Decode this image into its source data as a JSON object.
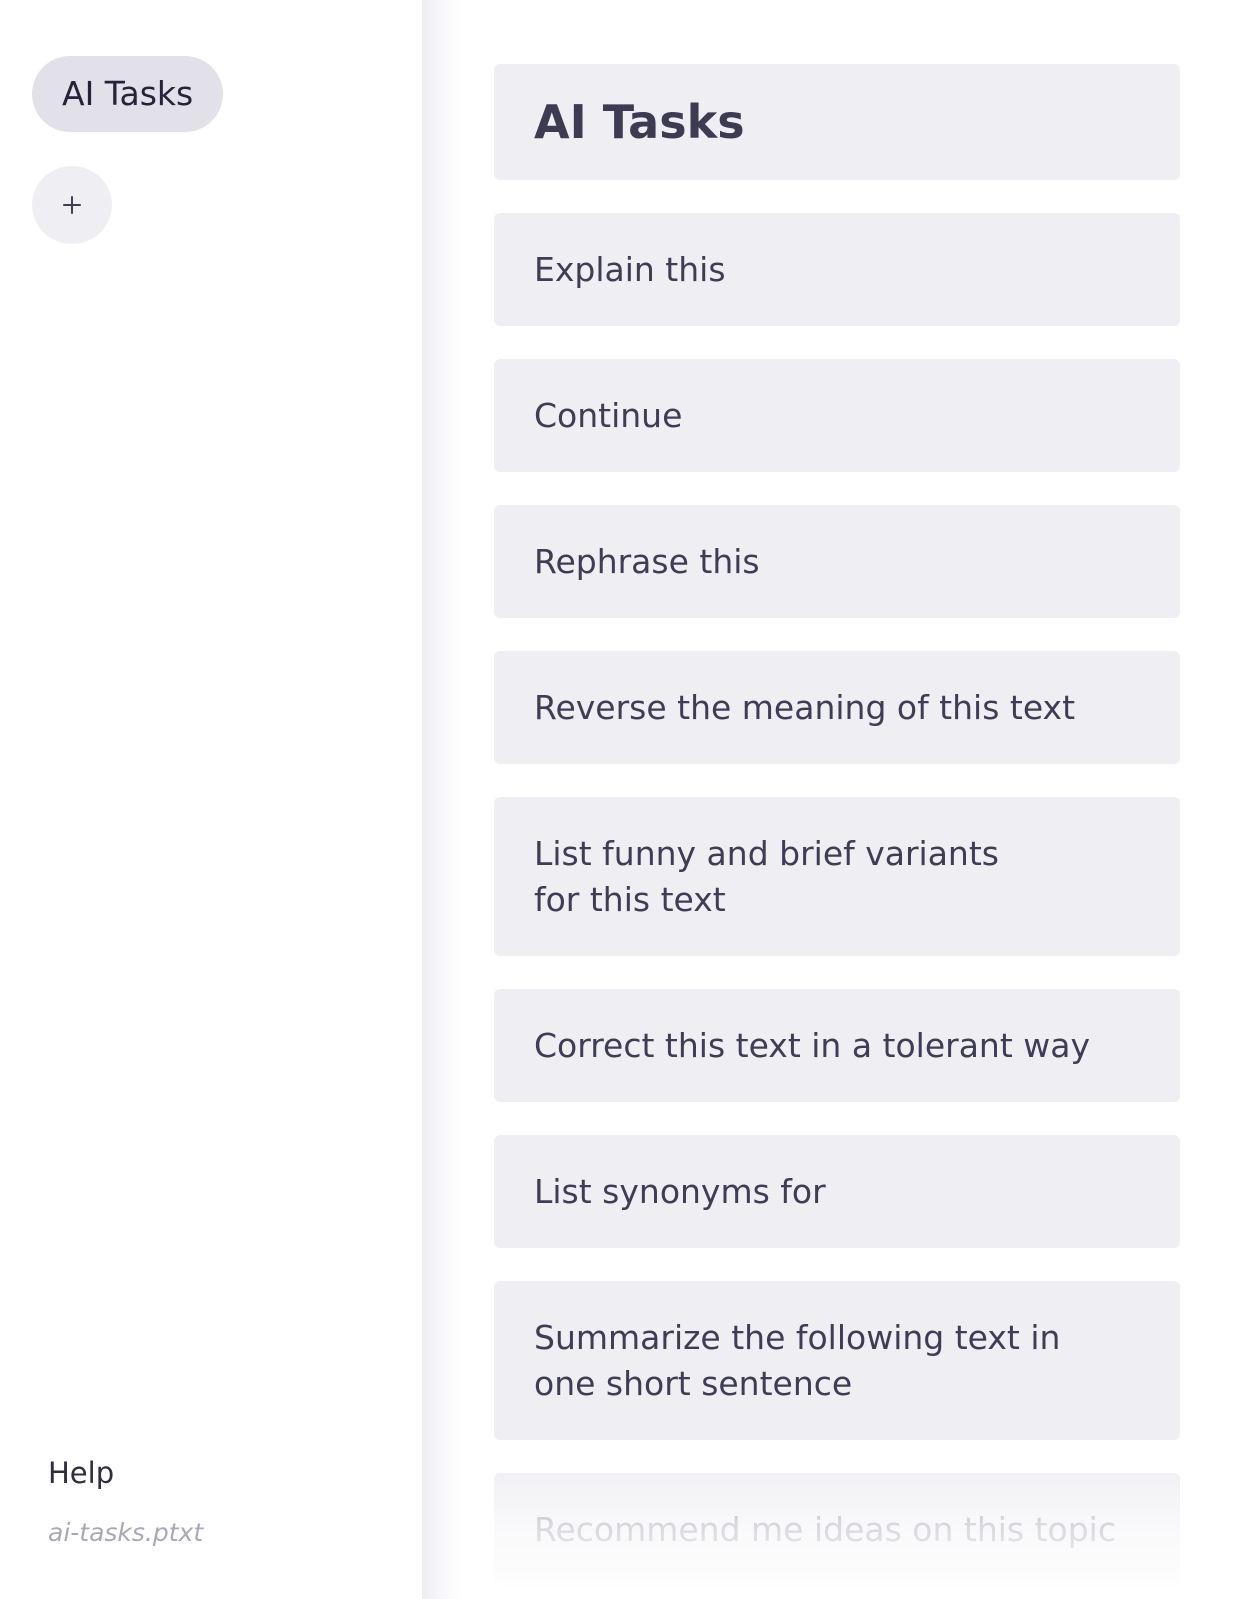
{
  "sidebar": {
    "tab_label": "AI Tasks",
    "add_label": "+",
    "help_label": "Help",
    "file_name": "ai-tasks.ptxt"
  },
  "main": {
    "title": "AI Tasks",
    "tasks": [
      "Explain this",
      "Continue",
      "Rephrase this",
      "Reverse the meaning of this text",
      "List funny and brief variants\nfor this text",
      "Correct this text in a tolerant way",
      "List synonyms for",
      "Summarize the following text in one short sentence",
      "Recommend me ideas on this topic"
    ]
  },
  "colors": {
    "card_background": "#efeef3",
    "tab_background": "#e2e0e8",
    "text": "#3f3d55",
    "muted_text": "#a9a8b6"
  }
}
